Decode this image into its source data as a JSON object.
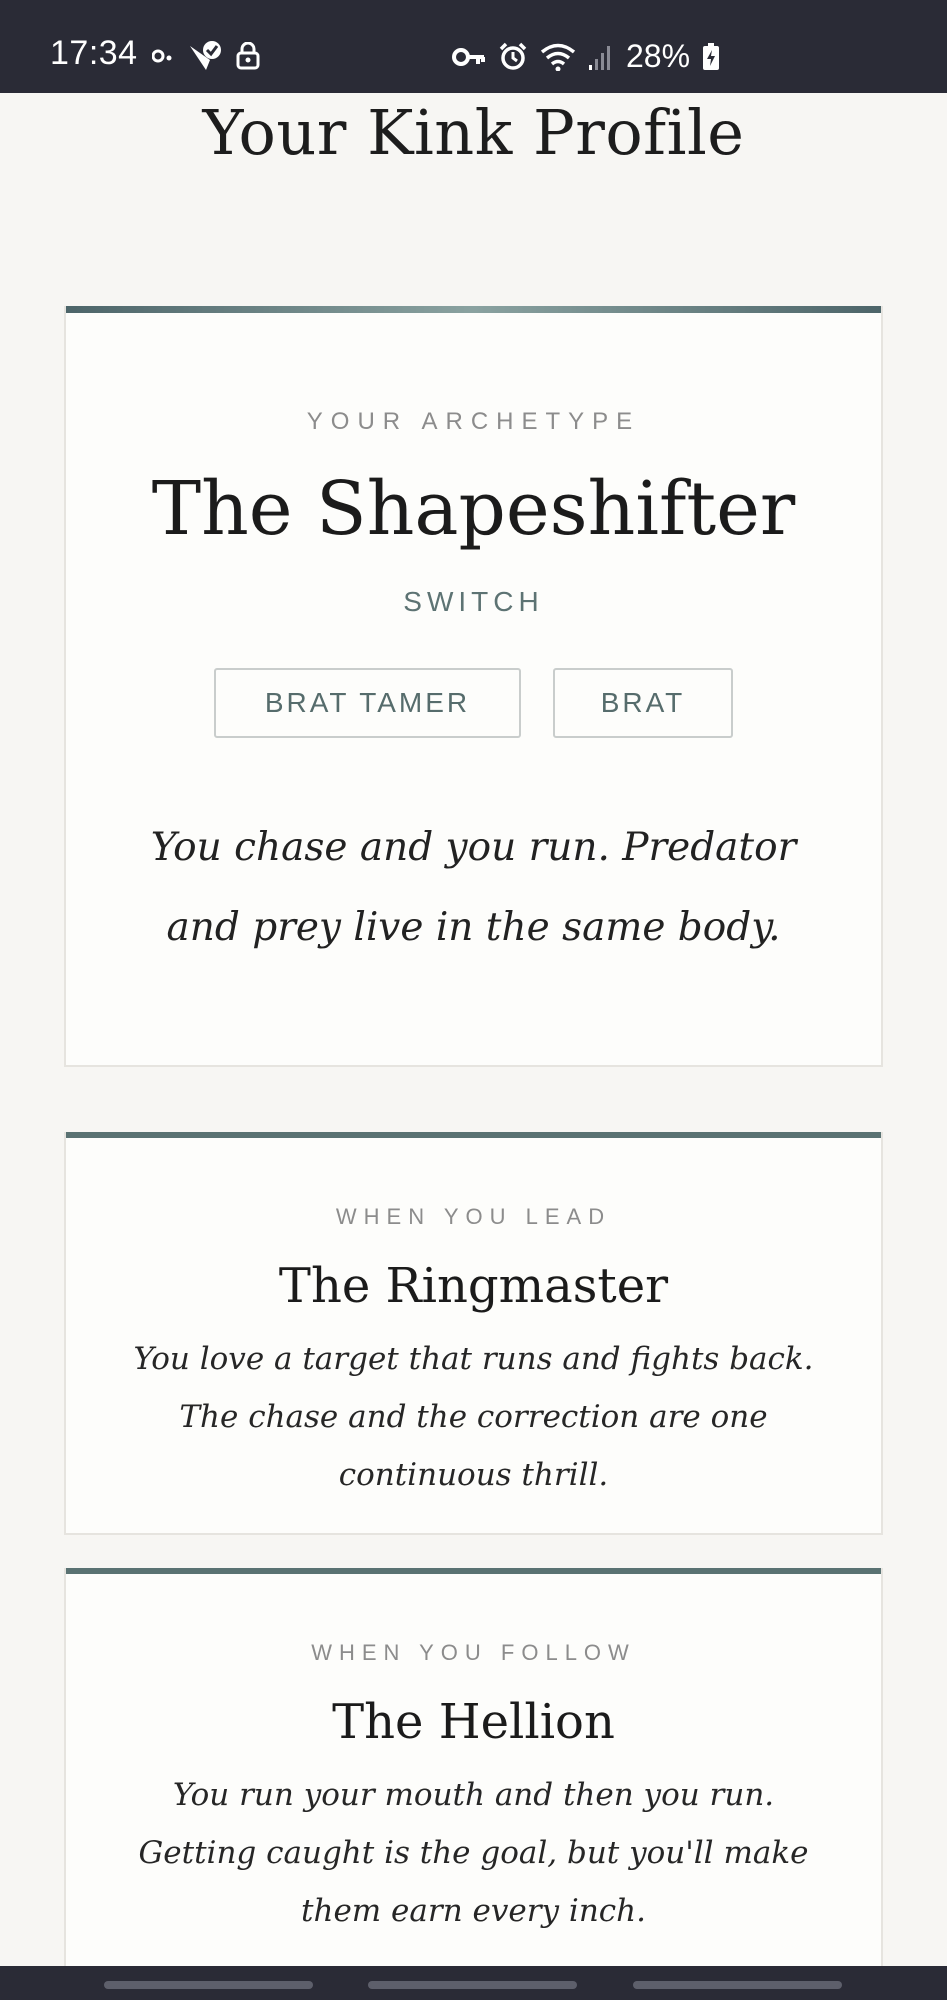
{
  "status_bar": {
    "time": "17:34",
    "battery": "28%",
    "icons": [
      "notification-icon",
      "vpn-check-icon",
      "lock-icon",
      "key-icon",
      "alarm-icon",
      "wifi-icon",
      "signal-icon",
      "battery-charging-icon"
    ]
  },
  "page": {
    "title": "Your Kink Profile"
  },
  "archetype_card": {
    "label": "YOUR ARCHETYPE",
    "name": "The Shapeshifter",
    "role": "SWITCH",
    "tags": [
      "BRAT TAMER",
      "BRAT"
    ],
    "quote": "You chase and you run. Predator and prey live in the same body."
  },
  "lead_card": {
    "label": "WHEN YOU LEAD",
    "name": "The Ringmaster",
    "description": "You love a target that runs and fights back. The chase and the correction are one continuous thrill."
  },
  "follow_card": {
    "label": "WHEN YOU FOLLOW",
    "name": "The Hellion",
    "description": "You run your mouth and then you run. Getting caught is the goal, but you'll make them earn every inch."
  },
  "colors": {
    "status_bar_bg": "#2a2b36",
    "page_bg": "#f7f6f3",
    "card_bg": "#fdfdfb",
    "accent": "#5a7272"
  }
}
